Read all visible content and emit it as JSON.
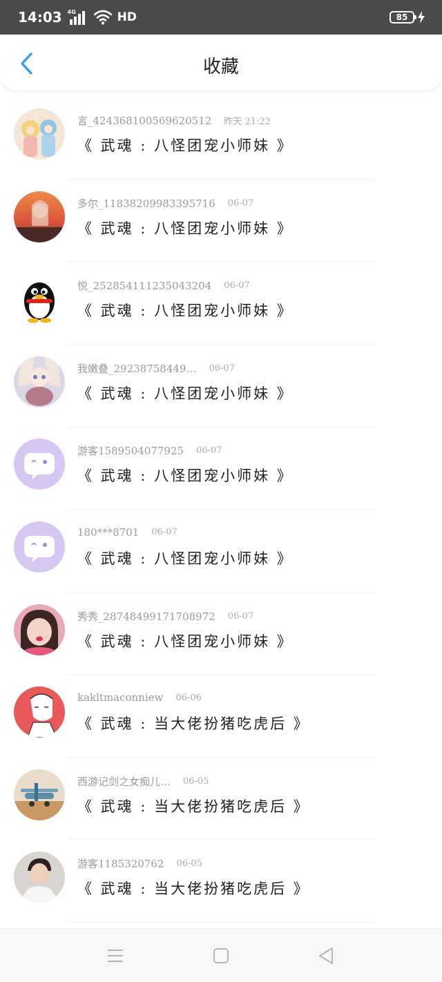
{
  "status_bar": {
    "time": "14:03",
    "network_tag": "4G",
    "hd": "HD",
    "battery": "85"
  },
  "header": {
    "title": "收藏",
    "back_icon": "chevron-left-icon",
    "accent_color": "#2a9df4"
  },
  "items": [
    {
      "user": "言_424368100569620512",
      "date": "昨天 21:22",
      "title": "《 武魂 : 八怪团宠小师妹 》",
      "avatar": "anime-girls"
    },
    {
      "user": "多尔_11838209983395716",
      "date": "06-07",
      "title": "《 武魂 : 八怪团宠小师妹 》",
      "avatar": "sunset-girl"
    },
    {
      "user": "悦_252854111235043204",
      "date": "06-07",
      "title": "《 武魂 : 八怪团宠小师妹 》",
      "avatar": "qq-penguin"
    },
    {
      "user": "我嫩叠_29238758449…",
      "date": "06-07",
      "title": "《 武魂 : 八怪团宠小师妹 》",
      "avatar": "anime-bunny"
    },
    {
      "user": "游客1589504077925",
      "date": "06-07",
      "title": "《 武魂 : 八怪团宠小师妹 》",
      "avatar": "default-chat"
    },
    {
      "user": "180***8701",
      "date": "06-07",
      "title": "《 武魂 : 八怪团宠小师妹 》",
      "avatar": "default-chat"
    },
    {
      "user": "秀秀_28748499171708972",
      "date": "06-07",
      "title": "《 武魂 : 八怪团宠小师妹 》",
      "avatar": "girl-photo"
    },
    {
      "user": "kakltmaconniew",
      "date": "06-06",
      "title": "《 武魂 : 当大佬扮猪吃虎后 》",
      "avatar": "sketch-boy"
    },
    {
      "user": "西游记剑之女痴儿…",
      "date": "06-05",
      "title": "《 武魂 : 当大佬扮猪吃虎后 》",
      "avatar": "toy-plane"
    },
    {
      "user": "游客1185320762",
      "date": "06-05",
      "title": "《 武魂 : 当大佬扮猪吃虎后 》",
      "avatar": "boy-photo"
    }
  ],
  "nav": {
    "menu_icon": "menu-icon",
    "home_icon": "square-home-icon",
    "back_icon": "triangle-back-icon"
  }
}
